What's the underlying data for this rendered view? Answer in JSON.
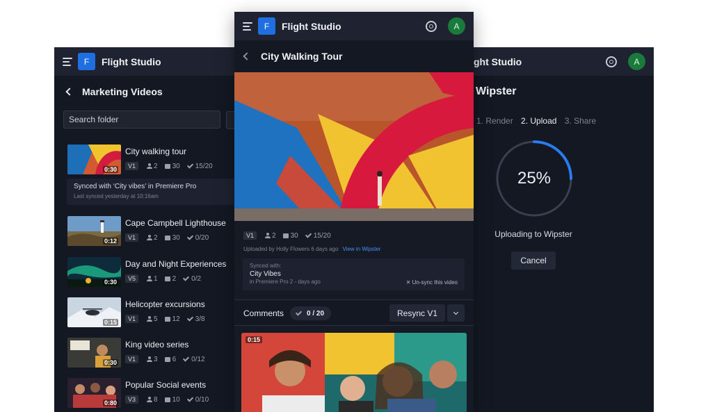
{
  "app": {
    "title": "Flight Studio",
    "logo_letter": "F",
    "avatar_letter": "A"
  },
  "left": {
    "folder_title": "Marketing Videos",
    "search_placeholder": "Search folder",
    "videos": [
      {
        "title": "City walking tour",
        "duration": "0:30",
        "version": "V1",
        "people": "2",
        "comments": "30",
        "approvals": "15/20"
      },
      {
        "title": "Cape Campbell Lighthouse",
        "duration": "0:12",
        "version": "V1",
        "people": "2",
        "comments": "30",
        "approvals": "0/20"
      },
      {
        "title": "Day and Night Experiences",
        "duration": "0:30",
        "version": "V5",
        "people": "1",
        "comments": "2",
        "approvals": "0/2"
      },
      {
        "title": "Helicopter excursions",
        "duration": "0:15",
        "version": "V1",
        "people": "5",
        "comments": "12",
        "approvals": "3/8"
      },
      {
        "title": "King video series",
        "duration": "0:30",
        "version": "V1",
        "people": "3",
        "comments": "6",
        "approvals": "0/12"
      },
      {
        "title": "Popular Social events",
        "duration": "0:80",
        "version": "V3",
        "people": "8",
        "comments": "10",
        "approvals": "0/10"
      }
    ],
    "sync_info": {
      "line1": "Synced with ‘City vibes’ in Premiere Pro",
      "line2": "Last synced yesterday at 10:16am"
    }
  },
  "middle": {
    "title": "City Walking Tour",
    "version": "V1",
    "people": "2",
    "comments": "30",
    "approvals": "15/20",
    "uploaded_by": "Uploaded by Holly Flowers 6 days ago",
    "view_link": "View in Wipster",
    "synced": {
      "label": "Synced with:",
      "name": "City Vibes",
      "detail": "in Premiere Pro 2 - days ago",
      "unsync": "✕  Un-sync this video"
    },
    "comments_label": "Comments",
    "comments_count": "0 / 20",
    "resync_label": "Resync V1",
    "second_video_duration": "0:15"
  },
  "right": {
    "app_partial": "ght Studio",
    "title": "Wipster",
    "steps": [
      "1. Render",
      "2. Upload",
      "3. Share"
    ],
    "active_step": 1,
    "progress": 0.25,
    "progress_label": "25%",
    "status": "Uploading to Wipster",
    "cancel_label": "Cancel"
  },
  "colors": {
    "bg": "#141823",
    "topbar": "#1f2331",
    "accent": "#1f6fe0",
    "progress": "#2b7bf0",
    "avatar": "#1a7a3c"
  }
}
